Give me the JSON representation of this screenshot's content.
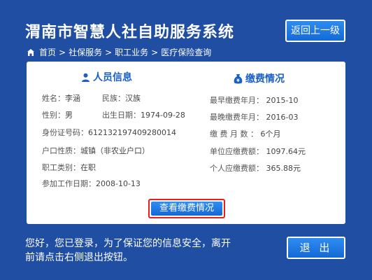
{
  "header": {
    "title": "渭南市智慧人社自助服务系统",
    "back_label": "返回上一级"
  },
  "breadcrumb": [
    "首页",
    ">",
    "社保服务",
    ">",
    "职工业务",
    ">",
    "医疗保险查询"
  ],
  "personal": {
    "section_title": "人员信息",
    "name_label": "姓名：",
    "name": "李涵",
    "ethnicity_label": "民族：",
    "ethnicity": "汉族",
    "gender_label": "性别：",
    "gender": "男",
    "birth_label": "出生日期：",
    "birth": "1974-09-28",
    "id_label": "身份证号码：",
    "id": "612132197409280014",
    "hukou_label": "户口性质：",
    "hukou": "城镇（非农业户口）",
    "worker_type_label": "职工类别：",
    "worker_type": "在职",
    "work_start_label": "参加工作日期：",
    "work_start": "2008-10-13"
  },
  "payment": {
    "section_title": "缴费情况",
    "earliest_label": "最早缴费年月：",
    "earliest": "2015-10",
    "latest_label": "最晚缴费年月：",
    "latest": "2016-03",
    "months_label": "缴 费 月 数 ：",
    "months": "6个月",
    "unit_label": "单位应缴费额：",
    "unit": "1097.64元",
    "personal_label": "个人应缴费额：",
    "personal": "365.88元"
  },
  "view_button": "查看缴费情况",
  "notice": "您好，您已登录，为了保证您的信息安全，离开前请点击右侧退出按钮。",
  "exit_label": "退 出"
}
